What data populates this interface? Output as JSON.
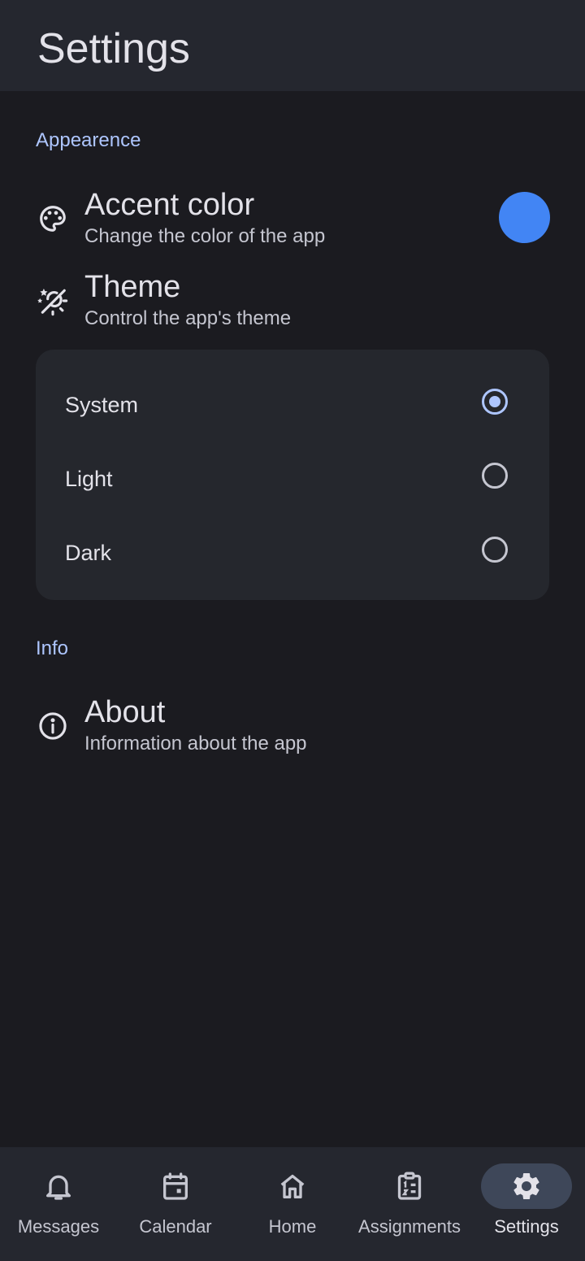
{
  "header": {
    "title": "Settings"
  },
  "sections": {
    "appearance": {
      "label": "Appearence",
      "accent": {
        "title": "Accent color",
        "subtitle": "Change the color of the app",
        "icon": "palette-icon",
        "color": "#4285f4"
      },
      "theme": {
        "title": "Theme",
        "subtitle": "Control the app's theme",
        "icon": "theme-icon",
        "options": [
          {
            "label": "System",
            "selected": true
          },
          {
            "label": "Light",
            "selected": false
          },
          {
            "label": "Dark",
            "selected": false
          }
        ]
      }
    },
    "info": {
      "label": "Info",
      "about": {
        "title": "About",
        "subtitle": "Information about the app",
        "icon": "info-icon"
      }
    }
  },
  "nav": {
    "items": [
      {
        "label": "Messages",
        "icon": "bell-icon",
        "active": false
      },
      {
        "label": "Calendar",
        "icon": "calendar-icon",
        "active": false
      },
      {
        "label": "Home",
        "icon": "home-icon",
        "active": false
      },
      {
        "label": "Assignments",
        "icon": "assignment-icon",
        "active": false
      },
      {
        "label": "Settings",
        "icon": "gear-icon",
        "active": true
      }
    ]
  },
  "colors": {
    "background": "#1b1b20",
    "surface": "#25272f",
    "primary": "#aec6ff",
    "accent_swatch": "#4285f4",
    "nav_active_pill": "#3e4759"
  }
}
